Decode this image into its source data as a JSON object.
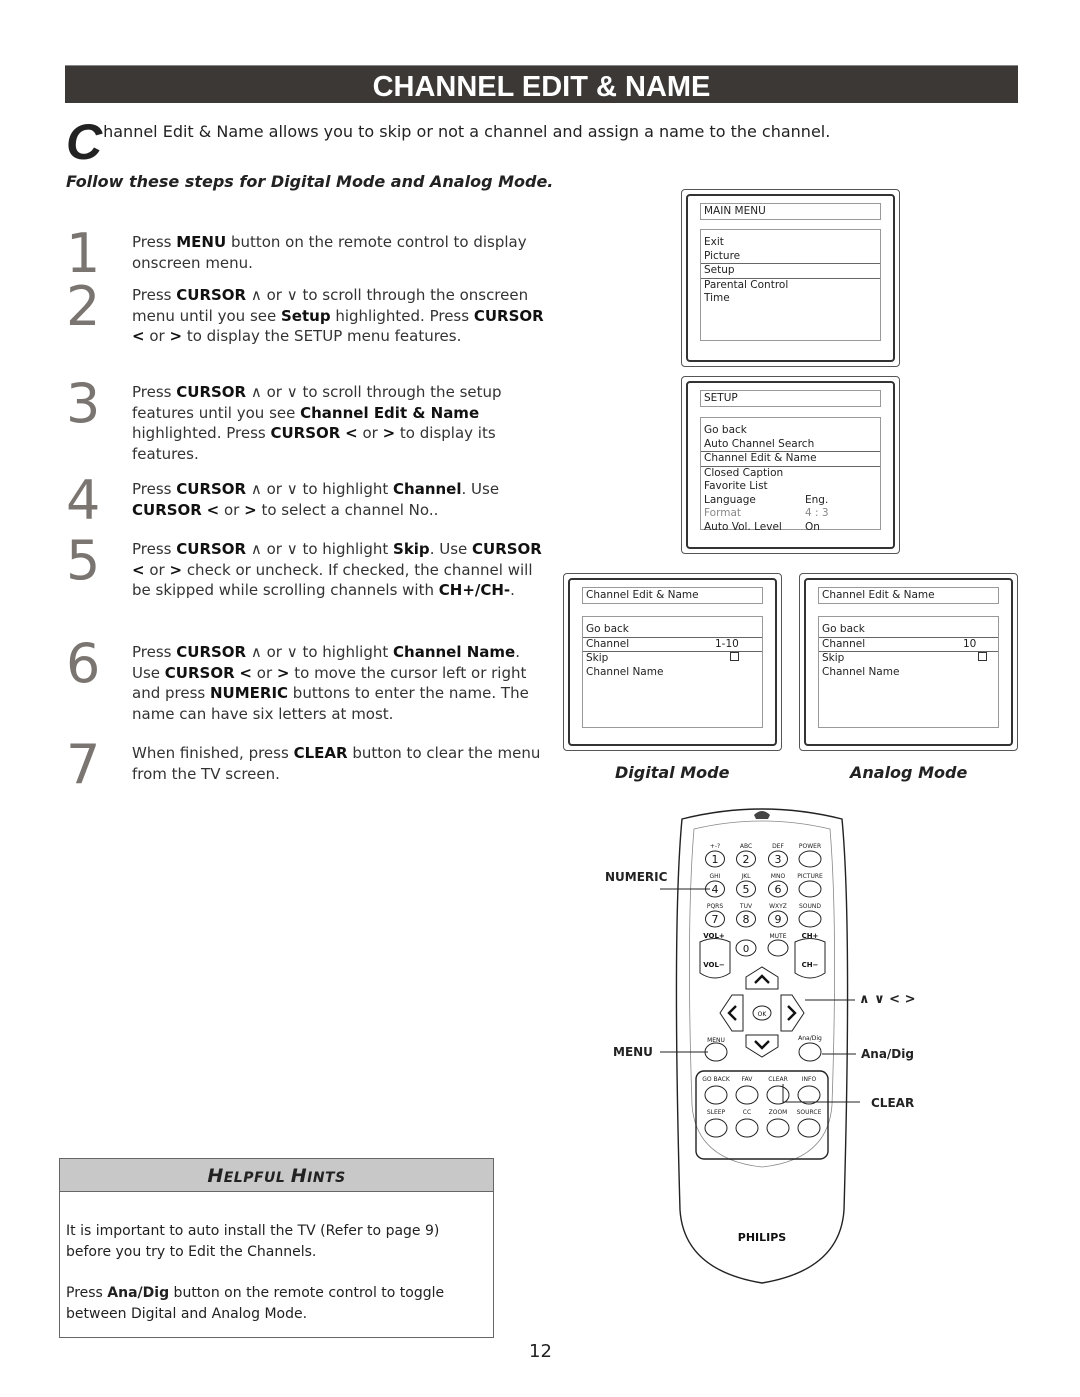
{
  "title": "CHANNEL EDIT & NAME",
  "intro": {
    "dropcap": "C",
    "text": "hannel Edit & Name allows you to skip or not a channel and assign a name to the channel."
  },
  "follow": "Follow these steps for Digital Mode and Analog Mode.",
  "steps": [
    {
      "num": "1",
      "html": "Press <b>MENU</b> button on the remote control to display onscreen menu."
    },
    {
      "num": "2",
      "html": "Press <b>CURSOR</b> &#8743; or &#8744; to scroll through the onscreen menu until you see <b>Setup</b> highlighted. Press <b>CURSOR</b> <b>&lt;</b> or <b>&gt;</b> to display the SETUP menu features."
    },
    {
      "num": "3",
      "html": "Press <b>CURSOR</b> &#8743; or &#8744; to scroll through the setup features until you see <b>Channel Edit &amp; Name</b> highlighted. Press <b>CURSOR</b> <b>&lt;</b> or <b>&gt;</b> to display its features."
    },
    {
      "num": "4",
      "html": "Press <b>CURSOR</b> &#8743; or &#8744; to highlight <b>Channel</b>. Use <b>CURSOR</b> <b>&lt;</b> or <b>&gt;</b> to select a channel No.."
    },
    {
      "num": "5",
      "html": "Press <b>CURSOR</b> &#8743; or &#8744; to highlight <b>Skip</b>. Use <b>CURSOR</b> <b>&lt;</b> or <b>&gt;</b> check or uncheck. If checked, the channel will be skipped while scrolling channels with <b>CH+/CH-</b>."
    },
    {
      "num": "6",
      "html": "Press <b>CURSOR</b> &#8743; or &#8744; to highlight <b>Channel Name</b>. Use <b>CURSOR</b> <b>&lt;</b> or <b>&gt;</b> to move the cursor left or right and press <b>NUMERIC</b> buttons to enter the name. The name can have six letters at most."
    },
    {
      "num": "7",
      "html": "When finished, press <b>CLEAR</b> button to clear the menu from the TV screen."
    }
  ],
  "screens": {
    "main_menu": {
      "header": "MAIN MENU",
      "items": [
        {
          "label": "Exit",
          "value": ""
        },
        {
          "label": "Picture",
          "value": ""
        },
        {
          "label": "Setup",
          "value": "",
          "selected": true
        },
        {
          "label": "Parental Control",
          "value": ""
        },
        {
          "label": "Time",
          "value": ""
        }
      ]
    },
    "setup": {
      "header": "SETUP",
      "items": [
        {
          "label": "Go back",
          "value": ""
        },
        {
          "label": "Auto Channel Search",
          "value": ""
        },
        {
          "label": "Channel Edit & Name",
          "value": "",
          "selected": true
        },
        {
          "label": "Closed Caption",
          "value": ""
        },
        {
          "label": "Favorite List",
          "value": ""
        },
        {
          "label": "Language",
          "value": "Eng."
        },
        {
          "label": "Format",
          "value": "4 : 3",
          "dim": true
        },
        {
          "label": "Auto Vol. Level",
          "value": "On"
        }
      ]
    },
    "digital": {
      "header": "Channel Edit & Name",
      "items": [
        {
          "label": "Go back",
          "value": ""
        },
        {
          "label": "Channel",
          "value": "1-10",
          "selected": true
        },
        {
          "label": "Skip",
          "value": "",
          "checkbox": true,
          "checked": false
        },
        {
          "label": "Channel Name",
          "value": ""
        }
      ],
      "mode_label": "Digital Mode"
    },
    "analog": {
      "header": "Channel Edit & Name",
      "items": [
        {
          "label": "Go back",
          "value": ""
        },
        {
          "label": "Channel",
          "value": "10",
          "selected": true
        },
        {
          "label": "Skip",
          "value": "",
          "checkbox": true,
          "checked": false
        },
        {
          "label": "Channel Name",
          "value": ""
        }
      ],
      "mode_label": "Analog Mode"
    }
  },
  "remote": {
    "brand": "PHILIPS",
    "callouts": {
      "numeric": "NUMERIC",
      "cursor": "∧ ∨ < >",
      "menu": "MENU",
      "anadig": "Ana/Dig",
      "clear": "CLEAR"
    },
    "keypad": [
      {
        "top": "+-?",
        "key": "1"
      },
      {
        "top": "ABC",
        "key": "2"
      },
      {
        "top": "DEF",
        "key": "3"
      },
      {
        "top": "POWER",
        "key": ""
      },
      {
        "top": "GHI",
        "key": "4"
      },
      {
        "top": "JKL",
        "key": "5"
      },
      {
        "top": "MNO",
        "key": "6"
      },
      {
        "top": "PICTURE",
        "key": ""
      },
      {
        "top": "PQRS",
        "key": "7"
      },
      {
        "top": "TUV",
        "key": "8"
      },
      {
        "top": "WXYZ",
        "key": "9"
      },
      {
        "top": "SOUND",
        "key": ""
      }
    ],
    "labels": {
      "vol_plus": "VOL+",
      "vol_minus": "VOL−",
      "ch_plus": "CH+",
      "ch_minus": "CH−",
      "mute": "MUTE",
      "zero": "0",
      "ok": "OK",
      "menu": "MENU",
      "anadig": "Ana/Dig"
    },
    "bottom_keys": [
      "GO BACK",
      "FAV",
      "CLEAR",
      "INFO",
      "SLEEP",
      "CC",
      "ZOOM",
      "SOURCE"
    ]
  },
  "hints": {
    "title": "Helpful Hints",
    "paragraphs": [
      "It is important to auto install the TV (Refer to page 9) before you try to Edit the Channels.",
      "Press <b>Ana/Dig</b> button on the remote control to toggle between Digital and Analog Mode."
    ]
  },
  "page_number": "12"
}
